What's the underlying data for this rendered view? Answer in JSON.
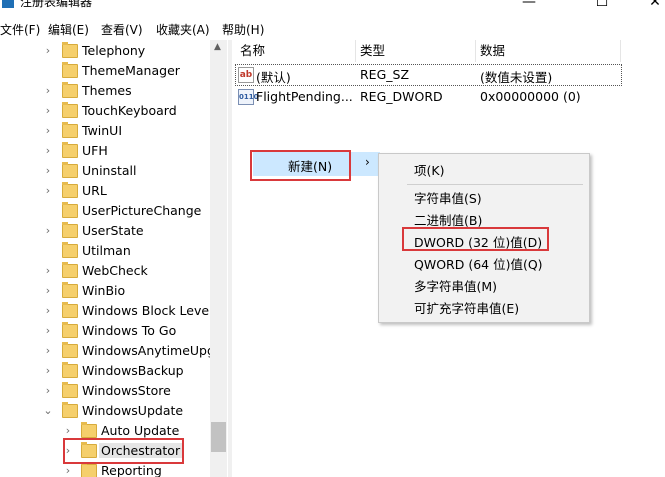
{
  "window": {
    "title": "注册表编辑器",
    "controls": {
      "minimize": "—",
      "maximize": "☐",
      "close": "✕"
    }
  },
  "menubar": {
    "items": [
      {
        "label": "文件(F)"
      },
      {
        "label": "编辑(E)"
      },
      {
        "label": "查看(V)"
      },
      {
        "label": "收藏夹(A)"
      },
      {
        "label": "帮助(H)"
      }
    ]
  },
  "tree": {
    "items": [
      {
        "label": "Telephony",
        "expander": "›"
      },
      {
        "label": "ThemeManager",
        "expander": ""
      },
      {
        "label": "Themes",
        "expander": "›"
      },
      {
        "label": "TouchKeyboard",
        "expander": "›"
      },
      {
        "label": "TwinUI",
        "expander": "›"
      },
      {
        "label": "UFH",
        "expander": "›"
      },
      {
        "label": "Uninstall",
        "expander": "›"
      },
      {
        "label": "URL",
        "expander": "›"
      },
      {
        "label": "UserPictureChange",
        "expander": ""
      },
      {
        "label": "UserState",
        "expander": "›"
      },
      {
        "label": "Utilman",
        "expander": ""
      },
      {
        "label": "WebCheck",
        "expander": "›"
      },
      {
        "label": "WinBio",
        "expander": "›"
      },
      {
        "label": "Windows Block Level",
        "expander": "›"
      },
      {
        "label": "Windows To Go",
        "expander": "›"
      },
      {
        "label": "WindowsAnytimeUpgr",
        "expander": "›"
      },
      {
        "label": "WindowsBackup",
        "expander": "›"
      },
      {
        "label": "WindowsStore",
        "expander": "›"
      },
      {
        "label": "WindowsUpdate",
        "expander": "⌄"
      },
      {
        "label": "Auto Update",
        "expander": "›"
      },
      {
        "label": "Orchestrator",
        "expander": "›",
        "selected": true
      },
      {
        "label": "Reporting",
        "expander": "›"
      }
    ],
    "scroll_up": "▲"
  },
  "values": {
    "headers": {
      "name": "名称",
      "type": "类型",
      "data": "数据"
    },
    "rows": [
      {
        "icon": "string-value-icon",
        "icon_text": "ab",
        "name": "(默认)",
        "type": "REG_SZ",
        "data": "(数值未设置)"
      },
      {
        "icon": "binary-value-icon",
        "icon_text": "011\n110",
        "name": "FlightPending...",
        "type": "REG_DWORD",
        "data": "0x00000000 (0)"
      }
    ]
  },
  "context_menu": {
    "new_label": "新建(N)",
    "new_arrow": "›",
    "submenu": [
      {
        "label": "项(K)"
      },
      {
        "label": "字符串值(S)"
      },
      {
        "label": "二进制值(B)"
      },
      {
        "label": "DWORD (32 位)值(D)",
        "highlighted": true
      },
      {
        "label": "QWORD (64 位)值(Q)"
      },
      {
        "label": "多字符串值(M)"
      },
      {
        "label": "可扩充字符串值(E)"
      }
    ]
  },
  "colors": {
    "highlight_border": "#d9393b",
    "menu_hover": "#cce8ff",
    "folder": "#f5cf6c"
  }
}
